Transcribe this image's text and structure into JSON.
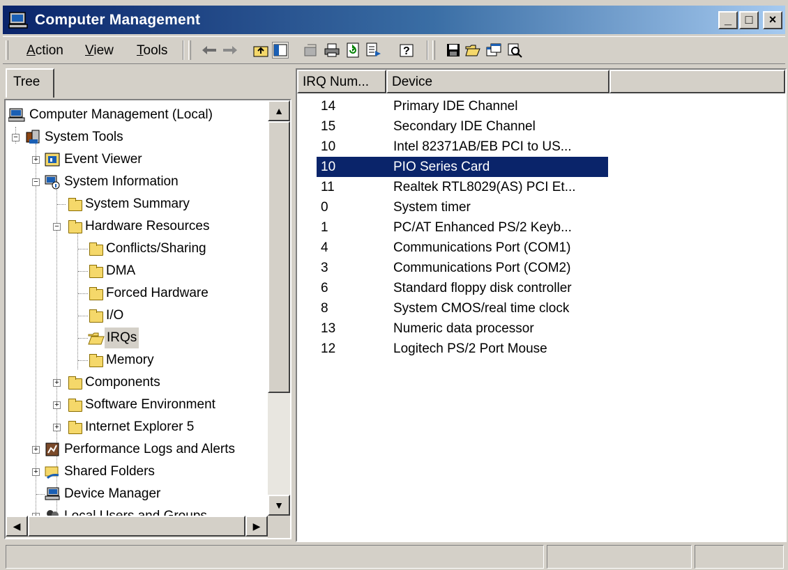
{
  "window": {
    "title": "Computer Management",
    "caption_buttons": {
      "minimize": "_",
      "maximize": "□",
      "close": "×"
    }
  },
  "menu": {
    "items": [
      {
        "label_ul": "A",
        "label_rest": "ction"
      },
      {
        "label_ul": "V",
        "label_rest": "iew"
      },
      {
        "label_ul": "T",
        "label_rest": "ools"
      }
    ]
  },
  "toolbar": {
    "icons": [
      "back-arrow-icon",
      "forward-arrow-icon",
      "up-one-level-icon",
      "show-hide-tree-icon",
      "properties-icon",
      "print-icon",
      "refresh-icon",
      "export-list-icon",
      "help-icon",
      "save-icon",
      "open-icon",
      "new-window-icon",
      "find-icon"
    ]
  },
  "tree": {
    "tab_label": "Tree",
    "nodes": [
      {
        "label": "Computer Management (Local)",
        "icon": "computer-icon"
      },
      {
        "label": "System Tools",
        "icon": "tools-icon",
        "expander": "−"
      },
      {
        "label": "Event Viewer",
        "icon": "event-viewer-icon",
        "expander": "+"
      },
      {
        "label": "System Information",
        "icon": "system-info-icon",
        "expander": "−"
      },
      {
        "label": "System Summary",
        "icon": "folder-icon"
      },
      {
        "label": "Hardware Resources",
        "icon": "folder-icon",
        "expander": "−"
      },
      {
        "label": "Conflicts/Sharing",
        "icon": "folder-icon"
      },
      {
        "label": "DMA",
        "icon": "folder-icon"
      },
      {
        "label": "Forced Hardware",
        "icon": "folder-icon"
      },
      {
        "label": "I/O",
        "icon": "folder-icon"
      },
      {
        "label": "IRQs",
        "icon": "folder-open-icon",
        "selected": true
      },
      {
        "label": "Memory",
        "icon": "folder-icon"
      },
      {
        "label": "Components",
        "icon": "folder-icon",
        "expander": "+"
      },
      {
        "label": "Software Environment",
        "icon": "folder-icon",
        "expander": "+"
      },
      {
        "label": "Internet Explorer 5",
        "icon": "folder-icon",
        "expander": "+"
      },
      {
        "label": "Performance Logs and Alerts",
        "icon": "performance-icon",
        "expander": "+"
      },
      {
        "label": "Shared Folders",
        "icon": "shared-folder-icon",
        "expander": "+"
      },
      {
        "label": "Device Manager",
        "icon": "device-manager-icon"
      },
      {
        "label": "Local Users and Groups",
        "icon": "users-icon",
        "expander": "+"
      }
    ]
  },
  "list": {
    "columns": [
      "IRQ Num...",
      "Device",
      ""
    ],
    "rows": [
      {
        "irq": "14",
        "device": "Primary IDE Channel"
      },
      {
        "irq": "15",
        "device": "Secondary IDE Channel"
      },
      {
        "irq": "10",
        "device": "Intel 82371AB/EB PCI to US..."
      },
      {
        "irq": "10",
        "device": "PIO Series Card",
        "selected": true
      },
      {
        "irq": "11",
        "device": "Realtek RTL8029(AS) PCI Et..."
      },
      {
        "irq": "0",
        "device": "System timer"
      },
      {
        "irq": "1",
        "device": "PC/AT Enhanced PS/2 Keyb..."
      },
      {
        "irq": "4",
        "device": "Communications Port (COM1)"
      },
      {
        "irq": "3",
        "device": "Communications Port (COM2)"
      },
      {
        "irq": "6",
        "device": "Standard floppy disk controller"
      },
      {
        "irq": "8",
        "device": "System CMOS/real time clock"
      },
      {
        "irq": "13",
        "device": "Numeric data processor"
      },
      {
        "irq": "12",
        "device": "Logitech PS/2 Port Mouse"
      }
    ]
  },
  "statusbar": {
    "cells": [
      "",
      "",
      ""
    ]
  },
  "colors": {
    "titlebar_start": "#0a246a",
    "titlebar_end": "#a6caf0",
    "selection": "#0a246a",
    "face": "#d4d0c8",
    "folder": "#f5d86a"
  }
}
